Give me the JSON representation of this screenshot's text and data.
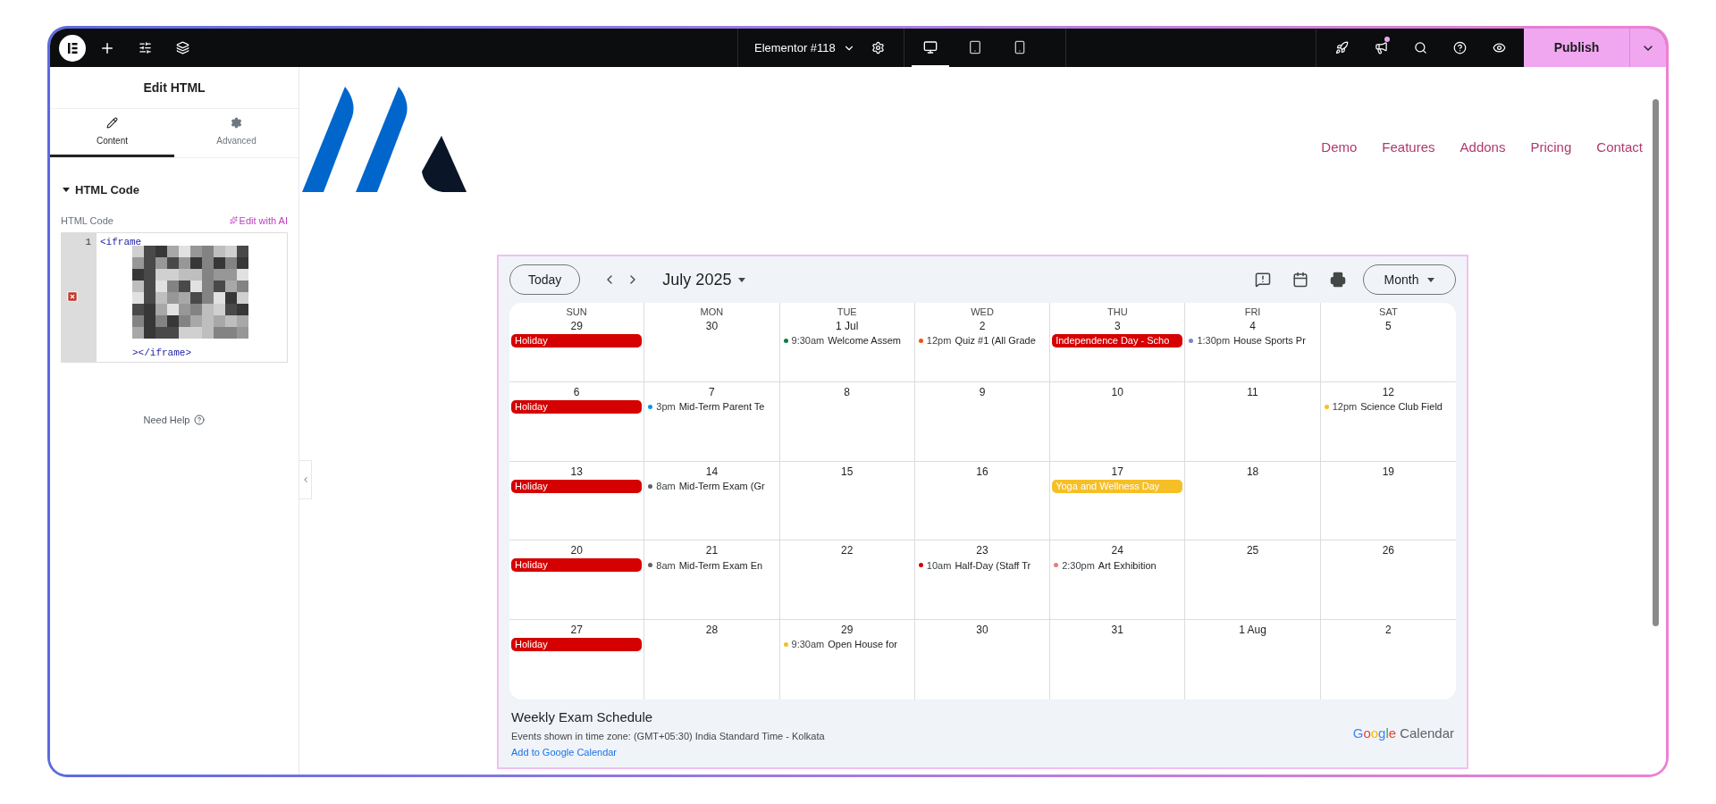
{
  "topbar": {
    "document_title": "Elementor #118",
    "devices": [
      {
        "kind": "desktop",
        "selected": true
      },
      {
        "kind": "tablet",
        "selected": false
      },
      {
        "kind": "mobile",
        "selected": false
      }
    ],
    "notification": true,
    "publish": "Publish"
  },
  "panel": {
    "title": "Edit HTML",
    "tabs": [
      {
        "label": "Content",
        "kind": "pencil",
        "selected": true
      },
      {
        "label": "Advanced",
        "kind": "gear",
        "selected": false
      }
    ],
    "section": {
      "title": "HTML Code",
      "expanded": true
    },
    "field_label": "HTML Code",
    "ai_link": "Edit with AI",
    "code": {
      "line_number": "1",
      "first_line": "<iframe",
      "last_line": "></iframe>",
      "error": true
    },
    "help": "Need Help"
  },
  "site": {
    "nav": [
      "Demo",
      "Features",
      "Addons",
      "Pricing",
      "Contact"
    ]
  },
  "calendar": {
    "today": "Today",
    "month": "July 2025",
    "view": "Month",
    "weekdays": [
      "SUN",
      "MON",
      "TUE",
      "WED",
      "THU",
      "FRI",
      "SAT"
    ],
    "cells": [
      {
        "date": "29",
        "events": [
          {
            "kind": "allday",
            "title": "Holiday",
            "color": "#d50000"
          }
        ]
      },
      {
        "date": "30"
      },
      {
        "date": "1 Jul",
        "events": [
          {
            "kind": "timed",
            "time": "9:30am",
            "title": "Welcome Assem",
            "color": "#0b8043"
          }
        ]
      },
      {
        "date": "2",
        "events": [
          {
            "kind": "timed",
            "time": "12pm",
            "title": "Quiz #1 (All Grade",
            "color": "#f4511e"
          }
        ]
      },
      {
        "date": "3",
        "events": [
          {
            "kind": "allday",
            "title": "Independence Day - Scho",
            "color": "#d50000"
          }
        ]
      },
      {
        "date": "4",
        "events": [
          {
            "kind": "timed",
            "time": "1:30pm",
            "title": "House Sports Pr",
            "color": "#7986cb"
          }
        ]
      },
      {
        "date": "5"
      },
      {
        "date": "6",
        "events": [
          {
            "kind": "allday",
            "title": "Holiday",
            "color": "#d50000"
          }
        ]
      },
      {
        "date": "7",
        "events": [
          {
            "kind": "timed",
            "time": "3pm",
            "title": "Mid-Term Parent Te",
            "color": "#039be5"
          }
        ]
      },
      {
        "date": "8"
      },
      {
        "date": "9"
      },
      {
        "date": "10"
      },
      {
        "date": "11"
      },
      {
        "date": "12",
        "events": [
          {
            "kind": "timed",
            "time": "12pm",
            "title": "Science Club Field",
            "color": "#f6bf26"
          }
        ]
      },
      {
        "date": "13",
        "events": [
          {
            "kind": "allday",
            "title": "Holiday",
            "color": "#d50000"
          }
        ]
      },
      {
        "date": "14",
        "events": [
          {
            "kind": "timed",
            "time": "8am",
            "title": "Mid-Term Exam (Gr",
            "color": "#616161"
          }
        ]
      },
      {
        "date": "15"
      },
      {
        "date": "16"
      },
      {
        "date": "17",
        "events": [
          {
            "kind": "allday",
            "title": "Yoga and Wellness Day",
            "color": "#f6bf26"
          }
        ]
      },
      {
        "date": "18"
      },
      {
        "date": "19"
      },
      {
        "date": "20",
        "events": [
          {
            "kind": "allday",
            "title": "Holiday",
            "color": "#d50000"
          }
        ]
      },
      {
        "date": "21",
        "events": [
          {
            "kind": "timed",
            "time": "8am",
            "title": "Mid-Term Exam En",
            "color": "#616161"
          }
        ]
      },
      {
        "date": "22"
      },
      {
        "date": "23",
        "events": [
          {
            "kind": "timed",
            "time": "10am",
            "title": "Half-Day (Staff Tr",
            "color": "#d50000"
          }
        ]
      },
      {
        "date": "24",
        "events": [
          {
            "kind": "timed",
            "time": "2:30pm",
            "title": "Art Exhibition",
            "color": "#e67c73"
          }
        ]
      },
      {
        "date": "25"
      },
      {
        "date": "26"
      },
      {
        "date": "27",
        "events": [
          {
            "kind": "allday",
            "title": "Holiday",
            "color": "#d50000"
          }
        ]
      },
      {
        "date": "28"
      },
      {
        "date": "29",
        "events": [
          {
            "kind": "timed",
            "time": "9:30am",
            "title": "Open House for",
            "color": "#f6bf26"
          }
        ]
      },
      {
        "date": "30"
      },
      {
        "date": "31"
      },
      {
        "date": "1 Aug"
      },
      {
        "date": "2"
      }
    ],
    "footer": {
      "title": "Weekly Exam Schedule",
      "timezone": "Events shown in time zone: (GMT+05:30) India Standard Time - Kolkata",
      "add_link": "Add to Google Calendar",
      "brand_google": "Google",
      "brand_product": "Calendar"
    }
  }
}
